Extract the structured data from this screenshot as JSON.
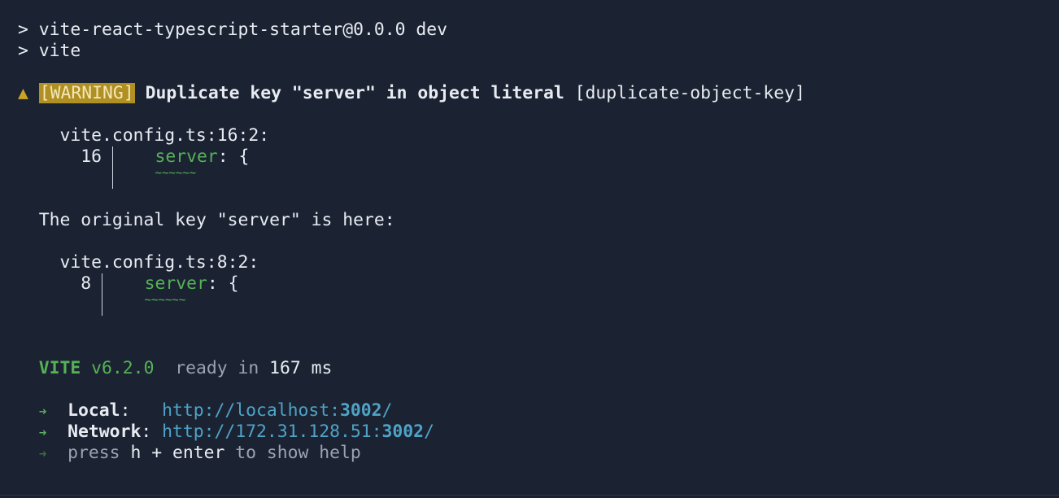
{
  "command": {
    "line1": "> vite-react-typescript-starter@0.0.0 dev",
    "line2": "> vite"
  },
  "warning": {
    "icon": "▲",
    "tag": "[WARNING]",
    "message": "Duplicate key \"server\" in object literal",
    "code": "[duplicate-object-key]"
  },
  "location1": {
    "file": "vite.config.ts:16:2:",
    "line_no": "16",
    "key": "server",
    "rest": ": {",
    "squiggle": "~~~~~~"
  },
  "note": "The original key \"server\" is here:",
  "location2": {
    "file": "vite.config.ts:8:2:",
    "line_no": "8",
    "key": "server",
    "rest": ": {",
    "squiggle": "~~~~~~"
  },
  "vite": {
    "name": "VITE",
    "version": "v6.2.0",
    "ready_text": "ready in",
    "ready_ms": "167",
    "ms_unit": "ms"
  },
  "urls": {
    "local_label": "Local",
    "local_prefix": "http://localhost:",
    "local_port": "3002",
    "local_suffix": "/",
    "network_label": "Network",
    "network_prefix": "http://172.31.128.51:",
    "network_port": "3002",
    "network_suffix": "/",
    "help_press": "press",
    "help_keys": "h + enter",
    "help_rest": "to show help",
    "arrow": "➜"
  },
  "colors": {
    "background": "#1b2333",
    "warning_tag_bg": "#b08f23",
    "green": "#56b156",
    "link": "#4fa3c6"
  }
}
